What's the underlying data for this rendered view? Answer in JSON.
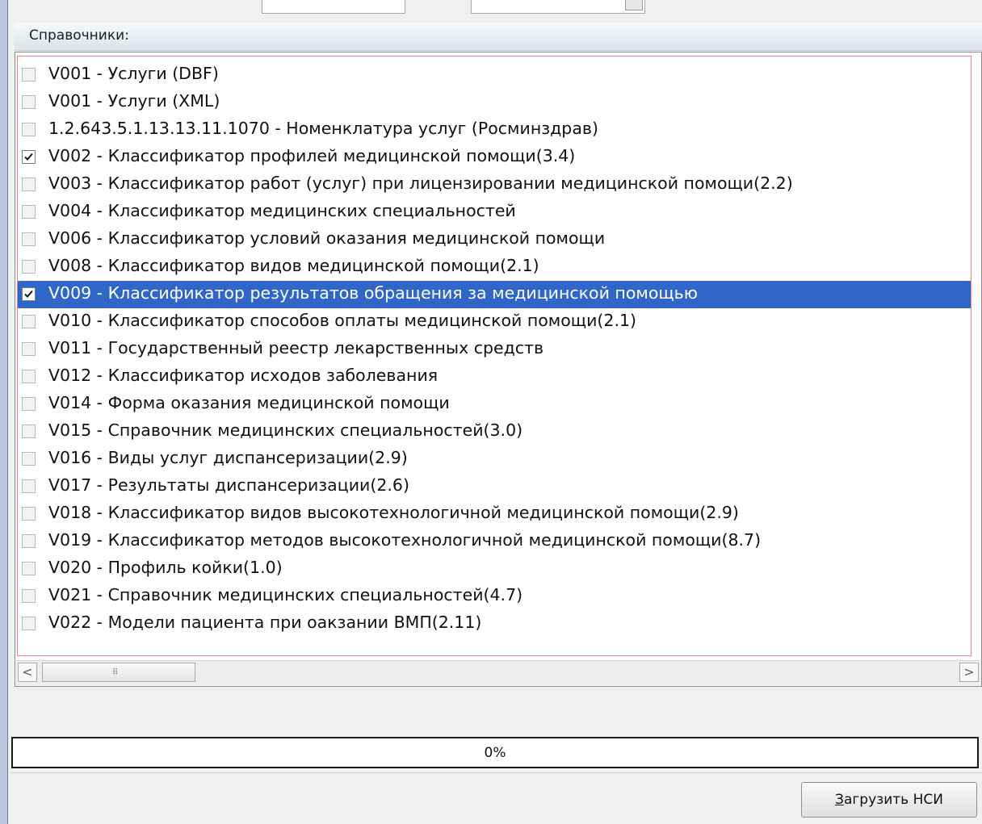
{
  "group": {
    "title": "Справочники:"
  },
  "list": {
    "items": [
      {
        "label": "V001 - Услуги (DBF)",
        "checked": false,
        "selected": false
      },
      {
        "label": "V001 - Услуги (XML)",
        "checked": false,
        "selected": false
      },
      {
        "label": "1.2.643.5.1.13.13.11.1070 - Номенклатура услуг (Росминздрав)",
        "checked": false,
        "selected": false
      },
      {
        "label": "V002 - Классификатор профилей медицинской помощи(3.4)",
        "checked": true,
        "selected": false
      },
      {
        "label": "V003 - Классификатор работ (услуг) при лицензировании медицинской помощи(2.2)",
        "checked": false,
        "selected": false
      },
      {
        "label": "V004 - Классификатор медицинских специальностей",
        "checked": false,
        "selected": false
      },
      {
        "label": "V006 - Классификатор условий оказания медицинской помощи",
        "checked": false,
        "selected": false
      },
      {
        "label": "V008 - Классификатор видов медицинской помощи(2.1)",
        "checked": false,
        "selected": false
      },
      {
        "label": "V009 - Классификатор результатов обращения за медицинской помощью",
        "checked": true,
        "selected": true
      },
      {
        "label": "V010 - Классификатор способов оплаты медицинской помощи(2.1)",
        "checked": false,
        "selected": false
      },
      {
        "label": "V011 - Государственный реестр лекарственных средств",
        "checked": false,
        "selected": false
      },
      {
        "label": "V012 - Классификатор исходов заболевания",
        "checked": false,
        "selected": false
      },
      {
        "label": "V014 - Форма оказания медицинской помощи",
        "checked": false,
        "selected": false
      },
      {
        "label": "V015 - Справочник медицинских специальностей(3.0)",
        "checked": false,
        "selected": false
      },
      {
        "label": "V016 - Виды услуг диспансеризации(2.9)",
        "checked": false,
        "selected": false
      },
      {
        "label": "V017 - Результаты диспансеризации(2.6)",
        "checked": false,
        "selected": false
      },
      {
        "label": "V018 - Классификатор видов высокотехнологичной медицинской помощи(2.9)",
        "checked": false,
        "selected": false
      },
      {
        "label": "V019 - Классификатор методов высокотехнологичной медицинской помощи(8.7)",
        "checked": false,
        "selected": false
      },
      {
        "label": "V020 - Профиль койки(1.0)",
        "checked": false,
        "selected": false
      },
      {
        "label": "V021 - Справочник медицинских специальностей(4.7)",
        "checked": false,
        "selected": false
      },
      {
        "label": "V022 - Модели пациента при оакзании ВМП(2.11)",
        "checked": false,
        "selected": false
      }
    ]
  },
  "scrollbar": {
    "left_arrow": "<",
    "right_arrow": ">",
    "grip": "⠿"
  },
  "progress": {
    "value": 0,
    "text": "0%",
    "fill_color": "#3a8a3a"
  },
  "actions": {
    "load_label_accel": "З",
    "load_label_rest": "агрузить НСИ"
  },
  "colors": {
    "selection": "#3066c8",
    "list_focus_border": "#f07f86"
  },
  "icons": {
    "check": "check-icon"
  }
}
